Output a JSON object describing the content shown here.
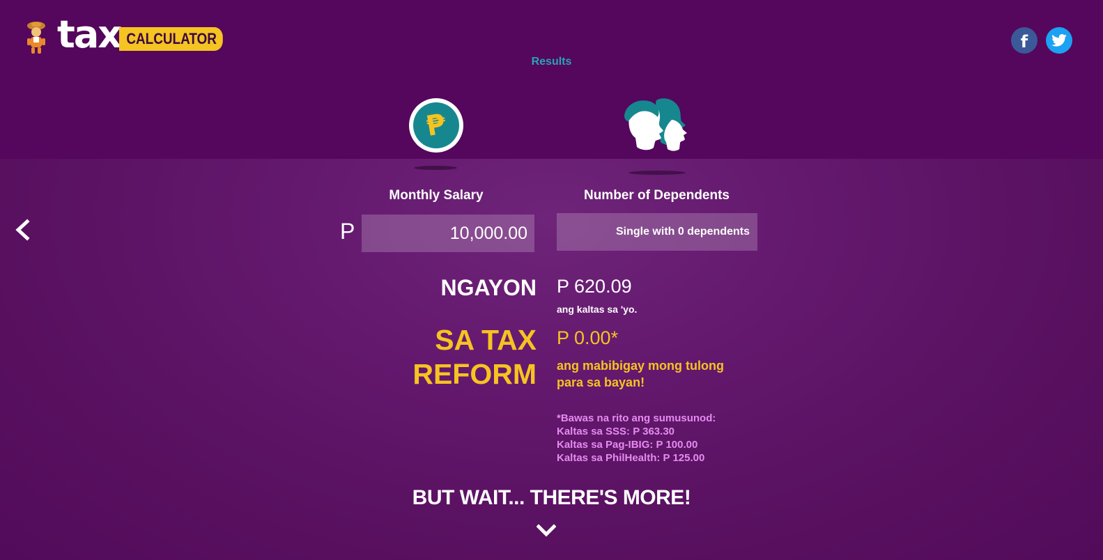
{
  "header": {
    "logo_word": "tax",
    "logo_badge": "CALCULATOR",
    "results_link": "Results"
  },
  "social": {
    "facebook_glyph": "f",
    "twitter_icon": "twitter-bird-icon"
  },
  "icons": {
    "salary_icon": "peso-coin-icon",
    "dependents_icon": "people-silhouettes-icon",
    "peso_glyph": "₱"
  },
  "form": {
    "salary_label": "Monthly Salary",
    "currency_prefix": "P",
    "salary_value": "10,000.00",
    "dependents_label": "Number of Dependents",
    "dependents_value": "Single with 0 dependents"
  },
  "results": {
    "ngayon_label": "NGAYON",
    "ngayon_amount": "P 620.09",
    "ngayon_caption": "ang kaltas sa 'yo.",
    "reform_label_line1": "SA TAX",
    "reform_label_line2": "REFORM",
    "reform_amount": "P 0.00*",
    "reform_caption": "ang mabibigay mong tulong para sa bayan!",
    "notes": [
      "*Bawas na rito ang sumusunod:",
      "Kaltas sa SSS: P 363.30",
      "Kaltas sa Pag-IBIG: P 100.00",
      "Kaltas sa PhilHealth: P 125.00"
    ]
  },
  "footer": {
    "more_text": "BUT WAIT... THERE'S MORE!"
  },
  "colors": {
    "background": "#54075c",
    "accent_yellow": "#f6c321",
    "accent_teal": "#29a3b5",
    "notes_pink": "#e58bf0",
    "facebook": "#3b5998",
    "twitter": "#1da1f2"
  }
}
